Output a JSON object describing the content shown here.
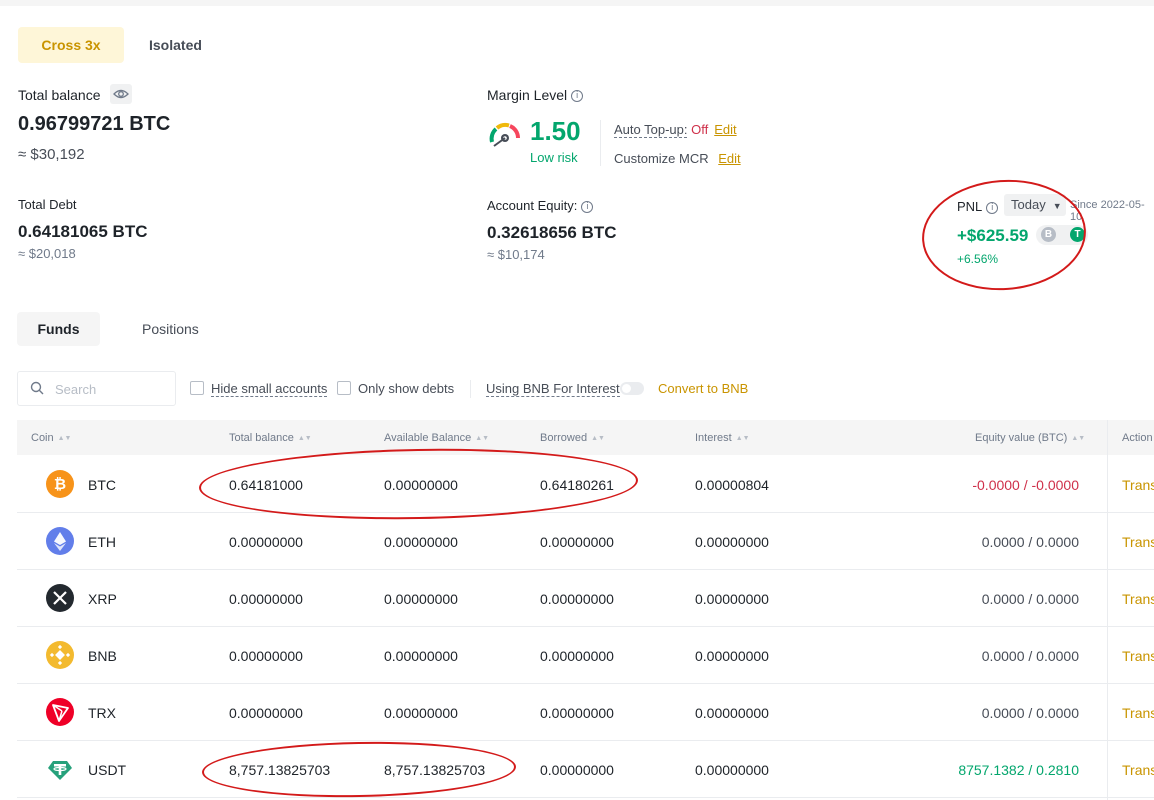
{
  "mode_tabs": [
    {
      "label": "Cross 3x"
    },
    {
      "label": "Isolated"
    }
  ],
  "summary": {
    "total_balance_label": "Total balance",
    "total_balance_btc": "0.96799721 BTC",
    "total_balance_usd": "≈ $30,192",
    "total_debt_label": "Total Debt",
    "total_debt_btc": "0.64181065 BTC",
    "total_debt_usd": "≈ $20,018",
    "margin_level_label": "Margin Level",
    "margin_level_value": "1.50",
    "margin_risk": "Low risk",
    "auto_topup_label": "Auto Top-up:",
    "auto_topup_value": "Off",
    "auto_topup_edit": "Edit",
    "mcr_label": "Customize MCR",
    "mcr_edit": "Edit",
    "account_equity_label": "Account Equity:",
    "account_equity_btc": "0.32618656 BTC",
    "account_equity_usd": "≈ $10,174",
    "pnl_label": "PNL",
    "pnl_period": "Today",
    "pnl_since": "Since 2022-05-10",
    "pnl_value": "+$625.59",
    "pnl_percent": "+6.56%",
    "pnl_unit_b": "B",
    "pnl_unit_t": "T"
  },
  "section_tabs": [
    {
      "label": "Funds"
    },
    {
      "label": "Positions"
    }
  ],
  "filters": {
    "search_placeholder": "Search",
    "hide_small": "Hide small accounts",
    "only_debts": "Only show debts",
    "bnb_interest": "Using BNB For Interest",
    "convert": "Convert to BNB"
  },
  "table": {
    "headers": {
      "coin": "Coin",
      "total": "Total balance",
      "available": "Available Balance",
      "borrowed": "Borrowed",
      "interest": "Interest",
      "equity": "Equity value (BTC)",
      "action": "Action"
    },
    "action_label": "Trans",
    "rows": [
      {
        "coin": "BTC",
        "total": "0.64181000",
        "available": "0.00000000",
        "borrowed": "0.64180261",
        "interest": "0.00000804",
        "equity": "-0.0000 / -0.0000",
        "icon_color": "#f7931a"
      },
      {
        "coin": "ETH",
        "total": "0.00000000",
        "available": "0.00000000",
        "borrowed": "0.00000000",
        "interest": "0.00000000",
        "equity": "0.0000 / 0.0000",
        "icon_color": "#627eea"
      },
      {
        "coin": "XRP",
        "total": "0.00000000",
        "available": "0.00000000",
        "borrowed": "0.00000000",
        "interest": "0.00000000",
        "equity": "0.0000 / 0.0000",
        "icon_color": "#23292f"
      },
      {
        "coin": "BNB",
        "total": "0.00000000",
        "available": "0.00000000",
        "borrowed": "0.00000000",
        "interest": "0.00000000",
        "equity": "0.0000 / 0.0000",
        "icon_color": "#f3ba2f"
      },
      {
        "coin": "TRX",
        "total": "0.00000000",
        "available": "0.00000000",
        "borrowed": "0.00000000",
        "interest": "0.00000000",
        "equity": "0.0000 / 0.0000",
        "icon_color": "#ef0027"
      },
      {
        "coin": "USDT",
        "total": "8,757.13825703",
        "available": "8,757.13825703",
        "borrowed": "0.00000000",
        "interest": "0.00000000",
        "equity": "8757.1382 / 0.2810",
        "icon_color": "#26a17b"
      }
    ]
  },
  "colors": {
    "accent": "#c99400",
    "positive": "#03a66d",
    "negative": "#cf304a",
    "annotation": "#d31a1a"
  }
}
